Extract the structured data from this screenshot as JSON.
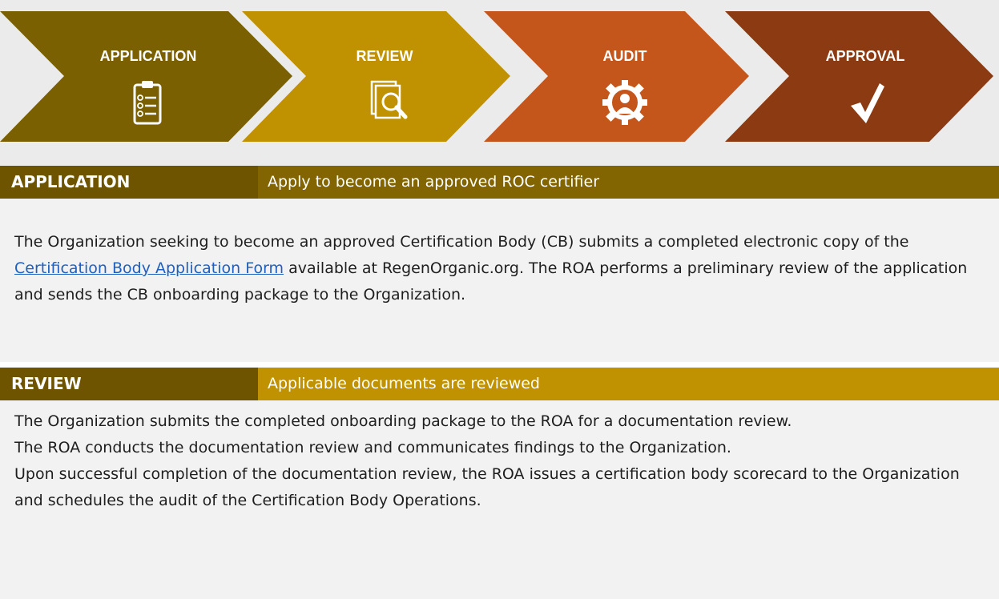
{
  "steps": [
    {
      "title": "APPLICATION",
      "icon": "clipboard-checklist-icon",
      "color": "#7a6000"
    },
    {
      "title": "REVIEW",
      "icon": "document-search-icon",
      "color": "#c09100"
    },
    {
      "title": "AUDIT",
      "icon": "gear-person-icon",
      "color": "#c4561b"
    },
    {
      "title": "APPROVAL",
      "icon": "checkmark-icon",
      "color": "#8b3a12"
    }
  ],
  "sections": {
    "application": {
      "label": "APPLICATION",
      "subtitle": "Apply to become an approved ROC certifier",
      "label_color": "#6f5400",
      "bar_color": "#826400",
      "text_before_link": "The Organization seeking to become an approved Certification Body (CB) submits a completed electronic copy of the ",
      "link_text": "Certification Body Application Form",
      "text_after_link": " available at RegenOrganic.org. The ROA performs a preliminary review of the application and sends the CB onboarding package to the Organization."
    },
    "review": {
      "label": "REVIEW",
      "subtitle": "Applicable documents are reviewed",
      "label_color": "#6f5400",
      "bar_color": "#c09100",
      "paragraphs": [
        "The Organization submits the completed onboarding package to the ROA for a documentation review.",
        "The ROA conducts the documentation review and communicates findings to the Organization.",
        "Upon successful completion of the documentation review, the ROA issues a certification body scorecard to the Organization and schedules the audit of the Certification Body Operations."
      ]
    }
  }
}
